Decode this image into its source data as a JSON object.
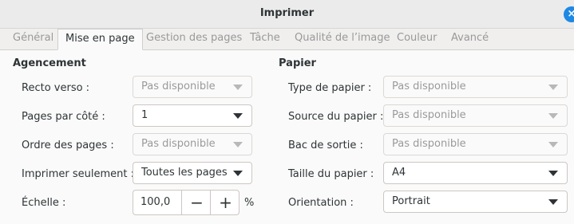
{
  "window": {
    "title": "Imprimer"
  },
  "tabs": [
    {
      "label": "Général",
      "active": false
    },
    {
      "label": "Mise en page",
      "active": true
    },
    {
      "label": "Gestion des pages",
      "active": false
    },
    {
      "label": "Tâche",
      "active": false
    },
    {
      "label": "Qualité de l’image",
      "active": false
    },
    {
      "label": "Couleur",
      "active": false
    },
    {
      "label": "Avancé",
      "active": false
    }
  ],
  "layout_section": {
    "title": "Agencement",
    "recto_verso": {
      "label": "Recto verso :",
      "value": "Pas disponible",
      "enabled": false
    },
    "pages_per_side": {
      "label": "Pages par côté :",
      "value": "1",
      "enabled": true
    },
    "page_order": {
      "label": "Ordre des pages :",
      "value": "Pas disponible",
      "enabled": false
    },
    "print_only": {
      "label": "Imprimer seulement :",
      "value": "Toutes les pages",
      "enabled": true
    },
    "scale": {
      "label": "Échelle :",
      "value": "100,0",
      "unit": "%",
      "minus": "−",
      "plus": "+"
    }
  },
  "paper_section": {
    "title": "Papier",
    "paper_type": {
      "label": "Type de papier :",
      "value": "Pas disponible",
      "enabled": false
    },
    "paper_source": {
      "label": "Source du papier :",
      "value": "Pas disponible",
      "enabled": false
    },
    "output_tray": {
      "label": "Bac de sortie :",
      "value": "Pas disponible",
      "enabled": false
    },
    "paper_size": {
      "label": "Taille du papier :",
      "value": "A4",
      "enabled": true
    },
    "orientation": {
      "label": "Orientation :",
      "value": "Portrait",
      "enabled": true
    }
  },
  "colors": {
    "accent": "#1e88e5",
    "disabled_text": "#9a9a9a"
  }
}
